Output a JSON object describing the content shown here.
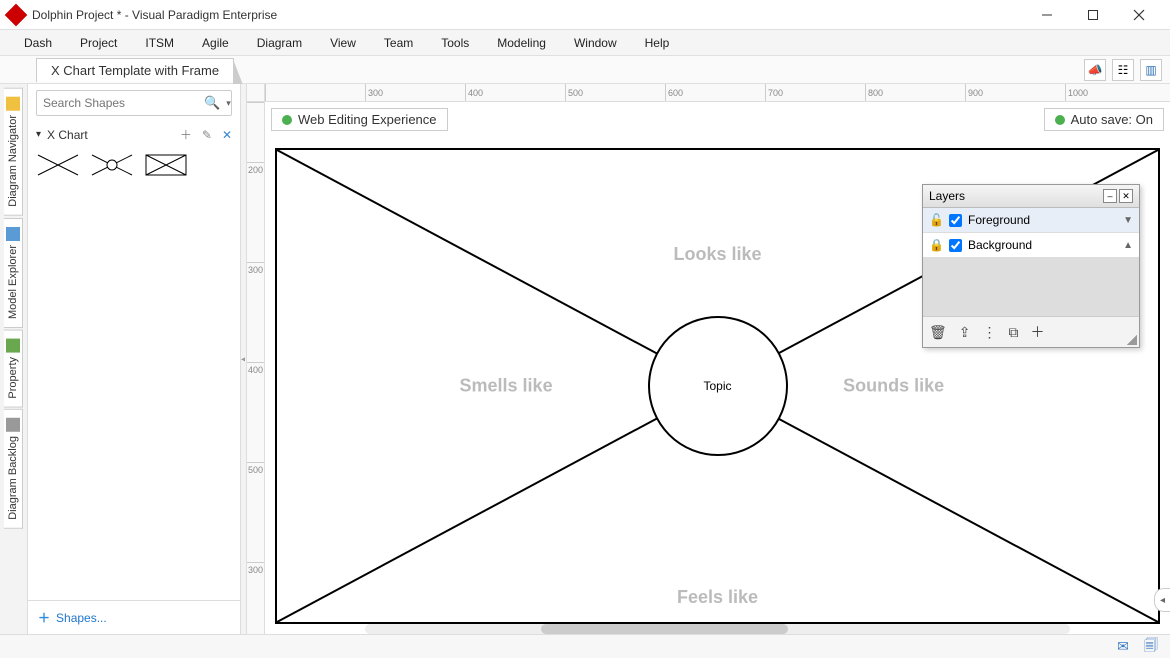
{
  "window": {
    "title": "Dolphin Project * - Visual Paradigm Enterprise"
  },
  "menu": {
    "items": [
      "Dash",
      "Project",
      "ITSM",
      "Agile",
      "Diagram",
      "View",
      "Team",
      "Tools",
      "Modeling",
      "Window",
      "Help"
    ]
  },
  "tab": {
    "active": "X Chart Template with Frame"
  },
  "sidebar_tabs": {
    "navigator": "Diagram Navigator",
    "model": "Model Explorer",
    "property": "Property",
    "backlog": "Diagram Backlog"
  },
  "shapes_panel": {
    "search_placeholder": "Search Shapes",
    "palette_name": "X Chart",
    "footer_link": "Shapes..."
  },
  "canvas": {
    "status_left": "Web Editing Experience",
    "status_right": "Auto save: On",
    "labels": {
      "top": "Looks like",
      "left": "Smells like",
      "right": "Sounds like",
      "bottom": "Feels like",
      "center": "Topic"
    },
    "ruler_h": [
      "",
      "300",
      "400",
      "500",
      "600",
      "700",
      "800",
      "900",
      "1000"
    ],
    "ruler_v": [
      "",
      "200",
      "300",
      "400",
      "500",
      "300"
    ]
  },
  "layers_panel": {
    "title": "Layers",
    "rows": [
      {
        "locked": false,
        "checked": true,
        "name": "Foreground",
        "triangle": "▼"
      },
      {
        "locked": true,
        "checked": true,
        "name": "Background",
        "triangle": "▲"
      }
    ]
  }
}
